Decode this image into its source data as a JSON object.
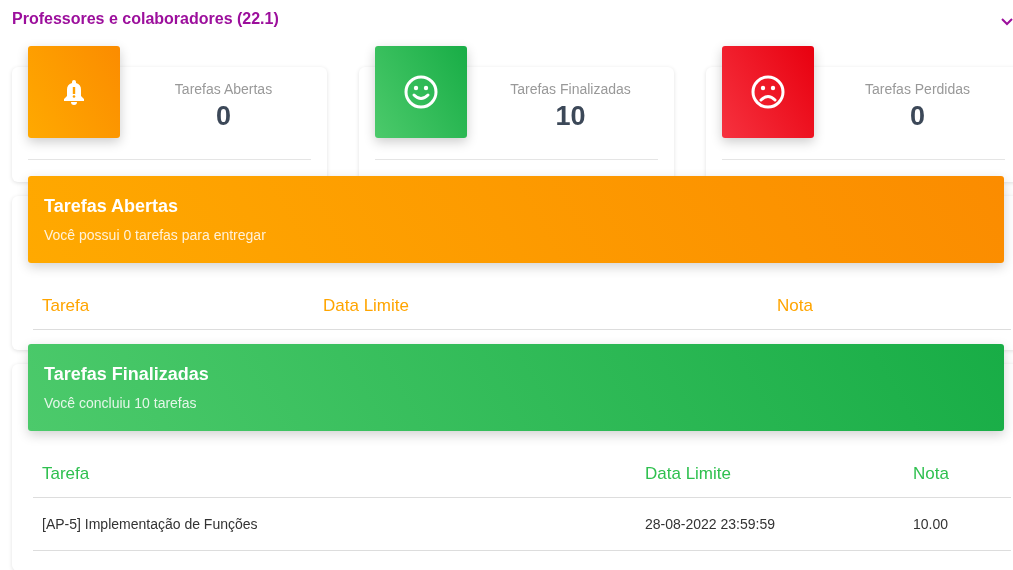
{
  "header": {
    "title": "Professores e colaboradores (22.1)",
    "expanded": true
  },
  "stats": [
    {
      "kind": "warning",
      "label": "Tarefas Abertas",
      "value": "0"
    },
    {
      "kind": "success",
      "label": "Tarefas Finalizadas",
      "value": "10"
    },
    {
      "kind": "danger",
      "label": "Tarefas Perdidas",
      "value": "0"
    }
  ],
  "sections": [
    {
      "kind": "warning",
      "title": "Tarefas Abertas",
      "subtitle": "Você possui 0 tarefas para entregar",
      "columns": [
        "Tarefa",
        "Data Limite",
        "Nota"
      ]
    },
    {
      "kind": "success",
      "title": "Tarefas Finalizadas",
      "subtitle": "Você concluiu 10 tarefas",
      "columns": [
        "Tarefa",
        "Data Limite",
        "Nota"
      ],
      "rows": [
        [
          "[AP-5] Implementação de Funções",
          "28-08-2022 23:59:59",
          "10.00"
        ]
      ]
    }
  ]
}
